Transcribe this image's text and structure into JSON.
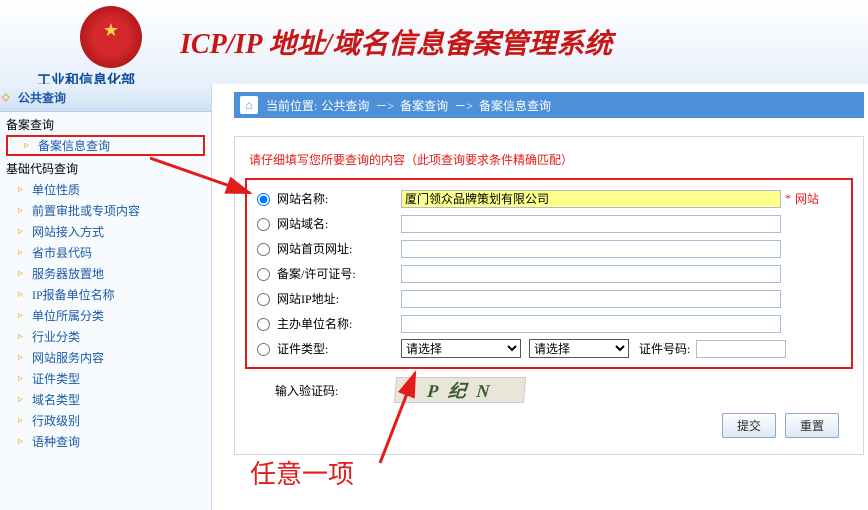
{
  "header": {
    "org": "工业和信息化部",
    "title": "ICP/IP 地址/域名信息备案管理系统"
  },
  "sidebar": {
    "title": "公共查询",
    "group1": "备案查询",
    "highlight": "备案信息查询",
    "group2": "基础代码查询",
    "items": [
      "单位性质",
      "前置审批或专项内容",
      "网站接入方式",
      "省市县代码",
      "服务器放置地",
      "IP报备单位名称",
      "单位所属分类",
      "行业分类",
      "网站服务内容",
      "证件类型",
      "域名类型",
      "行政级别",
      "语种查询"
    ]
  },
  "breadcrumb": {
    "prefix": "当前位置:",
    "p1": "公共查询",
    "p2": "备案查询",
    "p3": "备案信息查询",
    "sep": "－>"
  },
  "form": {
    "hint": "请仔细填写您所要查询的内容（此项查询要求条件精确匹配）",
    "rows": {
      "site_name": "网站名称:",
      "site_domain": "网站域名:",
      "site_home": "网站首页网址:",
      "license": "备案/许可证号:",
      "site_ip": "网站IP地址:",
      "sponsor": "主办单位名称:",
      "cert_type": "证件类型:"
    },
    "site_name_value": "厦门领众品牌策划有限公司",
    "req_star": "*",
    "req_text": "网站",
    "select_placeholder": "请选择",
    "cert_no_label": "证件号码:",
    "captcha_label": "输入验证码:",
    "captcha_text": "P 纪 N",
    "submit": "提交",
    "reset": "重置"
  },
  "annotation": "任意一项"
}
